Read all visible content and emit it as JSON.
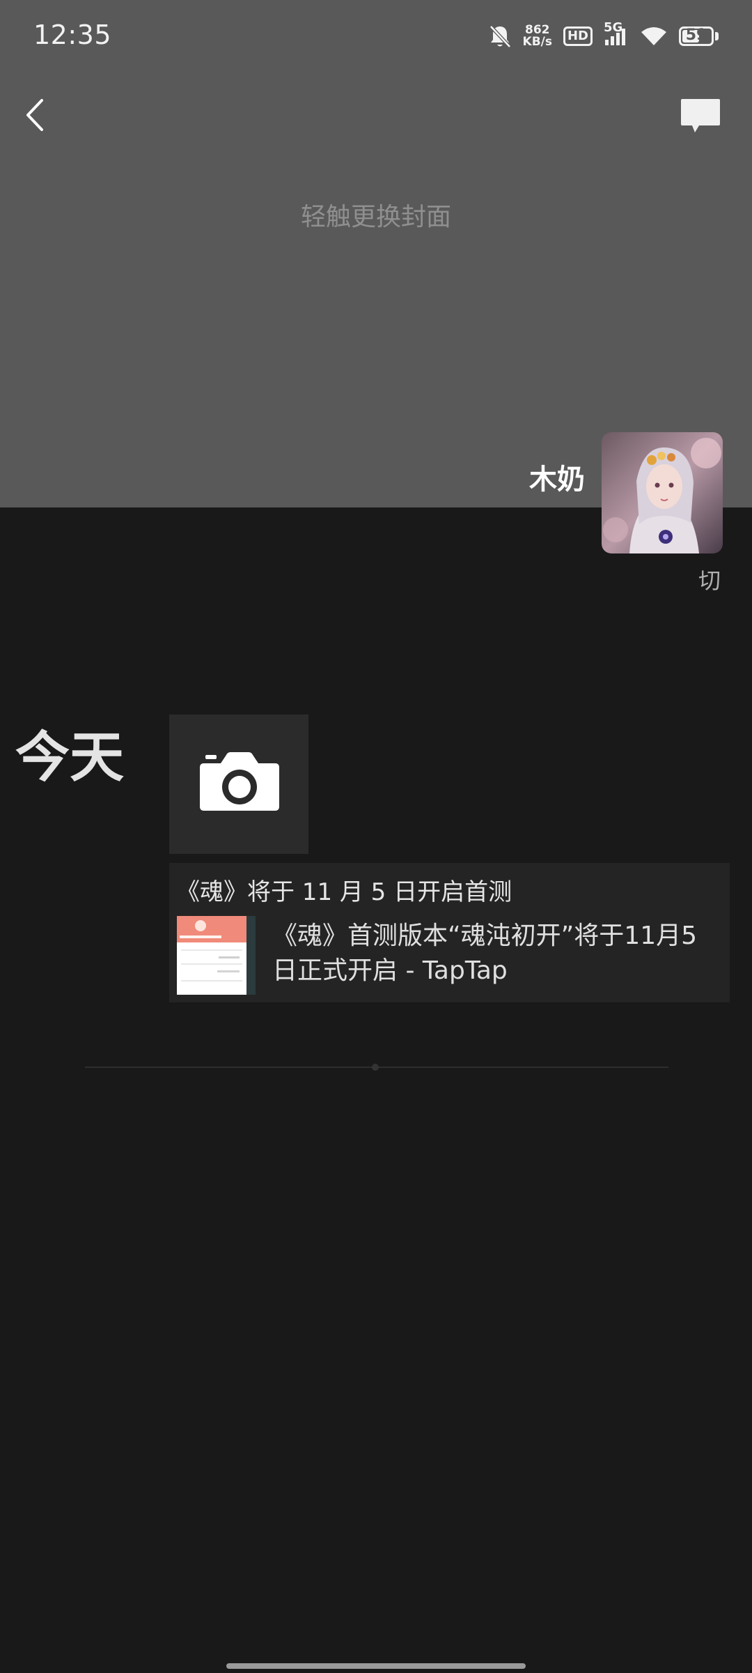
{
  "status_bar": {
    "time": "12:35",
    "net_speed_value": "862",
    "net_speed_unit": "KB/s",
    "hd_badge": "HD",
    "signal_label": "5G",
    "battery_level": "59",
    "icons": [
      "bell-muted-icon",
      "wifi-icon",
      "signal-icon",
      "battery-icon"
    ]
  },
  "header": {
    "back_icon": "chevron-left-icon",
    "message_icon": "message-icon"
  },
  "cover": {
    "hint": "轻触更换封面"
  },
  "profile": {
    "name": "木奶",
    "avatar_caption": "切"
  },
  "feed": {
    "date_label": "今天",
    "camera_icon": "camera-icon",
    "post": {
      "title": "《魂》将于 11 月 5 日开启首测",
      "link_text": "《魂》首测版本“魂沌初开”将于11月5日正式开启 - TapTap"
    }
  },
  "colors": {
    "cover_bg": "#595959",
    "page_bg": "#191919",
    "card_bg": "#242424"
  }
}
